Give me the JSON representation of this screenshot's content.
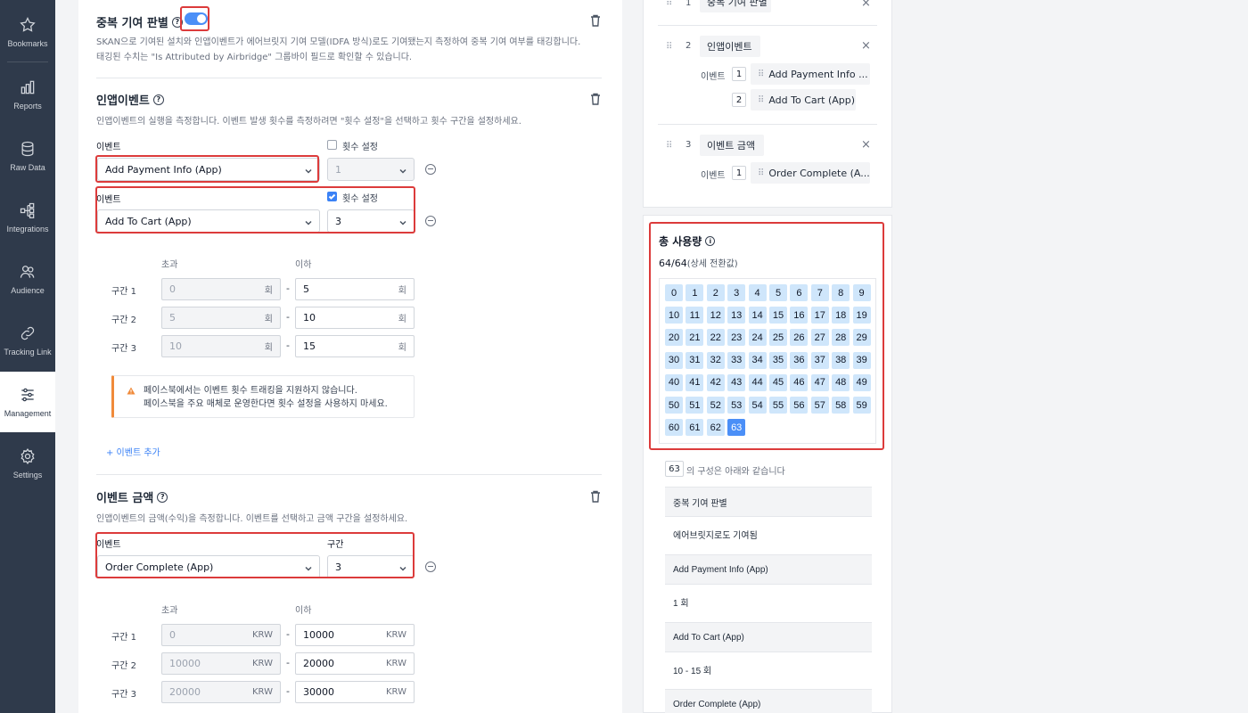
{
  "sidebar": {
    "items": [
      {
        "label": "Bookmarks",
        "icon": "star-icon"
      },
      {
        "label": "Reports",
        "icon": "bar-chart-icon"
      },
      {
        "label": "Raw Data",
        "icon": "database-icon"
      },
      {
        "label": "Integrations",
        "icon": "integrations-icon"
      },
      {
        "label": "Audience",
        "icon": "users-icon"
      },
      {
        "label": "Tracking Link",
        "icon": "link-icon"
      },
      {
        "label": "Management",
        "icon": "sliders-icon"
      },
      {
        "label": "Settings",
        "icon": "gear-icon"
      }
    ],
    "active": "Management"
  },
  "dup": {
    "title": "중복 기여 판별",
    "toggle_on": true,
    "desc1": "SKAN으로 기여된 설치와 인앱이벤트가 에어브릿지 기여 모델(IDFA 방식)로도 기여됐는지 측정하여 중복 기여 여부를 태깅합니다.",
    "desc2": "태깅된 수치는 \"Is Attributed by Airbridge\" 그룹바이 필드로 확인할 수 있습니다."
  },
  "inapp": {
    "title": "인앱이벤트",
    "desc": "인앱이벤트의 실행을 측정합니다. 이벤트 발생 횟수를 측정하려면 \"횟수 설정\"을 선택하고 횟수 구간을 설정하세요.",
    "event_label": "이벤트",
    "count_label": "횟수 설정",
    "rows": [
      {
        "event": "Add Payment Info (App)",
        "count": "1",
        "checked": false
      },
      {
        "event": "Add To Cart (App)",
        "count": "3",
        "checked": true
      }
    ],
    "over_label": "초과",
    "under_label": "이하",
    "unit": "회",
    "ranges": [
      {
        "label": "구간 1",
        "from": "0",
        "to": "5"
      },
      {
        "label": "구간 2",
        "from": "5",
        "to": "10"
      },
      {
        "label": "구간 3",
        "from": "10",
        "to": "15"
      }
    ],
    "warning1": "페이스북에서는 이벤트 횟수 트래킹을 지원하지 않습니다.",
    "warning2": "페이스북을 주요 매체로 운영한다면 횟수 설정을 사용하지 마세요.",
    "add_event": "+ 이벤트 추가"
  },
  "revenue": {
    "title": "이벤트 금액",
    "desc": "인앱이벤트의 금액(수익)을 측정합니다. 이벤트를 선택하고 금액 구간을 설정하세요.",
    "event_label": "이벤트",
    "range_label": "구간",
    "event": "Order Complete (App)",
    "range_count": "3",
    "over_label": "초과",
    "under_label": "이하",
    "unit": "KRW",
    "ranges": [
      {
        "label": "구간 1",
        "from": "0",
        "to": "10000"
      },
      {
        "label": "구간 2",
        "from": "10000",
        "to": "20000"
      },
      {
        "label": "구간 3",
        "from": "20000",
        "to": "30000"
      }
    ]
  },
  "summary": {
    "groups": [
      {
        "num": "1",
        "name": "중복 기여 판별"
      },
      {
        "num": "2",
        "name": "인앱이벤트",
        "sub_label": "이벤트",
        "events": [
          {
            "n": "1",
            "name": "Add Payment Info ..."
          },
          {
            "n": "2",
            "name": "Add To Cart (App)"
          }
        ]
      },
      {
        "num": "3",
        "name": "이벤트 금액",
        "sub_label": "이벤트",
        "events": [
          {
            "n": "1",
            "name": "Order Complete (A..."
          }
        ]
      }
    ]
  },
  "usage": {
    "title": "총 사용량",
    "count": "64/64",
    "count_note": "(상세 전환값)",
    "selected": "63",
    "values": [
      "0",
      "1",
      "2",
      "3",
      "4",
      "5",
      "6",
      "7",
      "8",
      "9",
      "10",
      "11",
      "12",
      "13",
      "14",
      "15",
      "16",
      "17",
      "18",
      "19",
      "20",
      "21",
      "22",
      "23",
      "24",
      "25",
      "26",
      "27",
      "28",
      "29",
      "30",
      "31",
      "32",
      "33",
      "34",
      "35",
      "36",
      "37",
      "38",
      "39",
      "40",
      "41",
      "42",
      "43",
      "44",
      "45",
      "46",
      "47",
      "48",
      "49",
      "50",
      "51",
      "52",
      "53",
      "54",
      "55",
      "56",
      "57",
      "58",
      "59",
      "60",
      "61",
      "62",
      "63"
    ],
    "composition_text": "의 구성은 아래와 같습니다",
    "composition": [
      {
        "head": "중복 기여 판별",
        "value": "에어브릿지로도 기여됨"
      },
      {
        "head": "Add Payment Info (App)",
        "value": "1 회"
      },
      {
        "head": "Add To Cart (App)",
        "value": "10 - 15 회"
      },
      {
        "head": "Order Complete (App)",
        "value": ""
      }
    ]
  },
  "colors": {
    "accent": "#4b8ff7",
    "highlight": "#dc3b3b",
    "sidebar": "#2f3a4b",
    "cell": "#cfe6fb"
  }
}
